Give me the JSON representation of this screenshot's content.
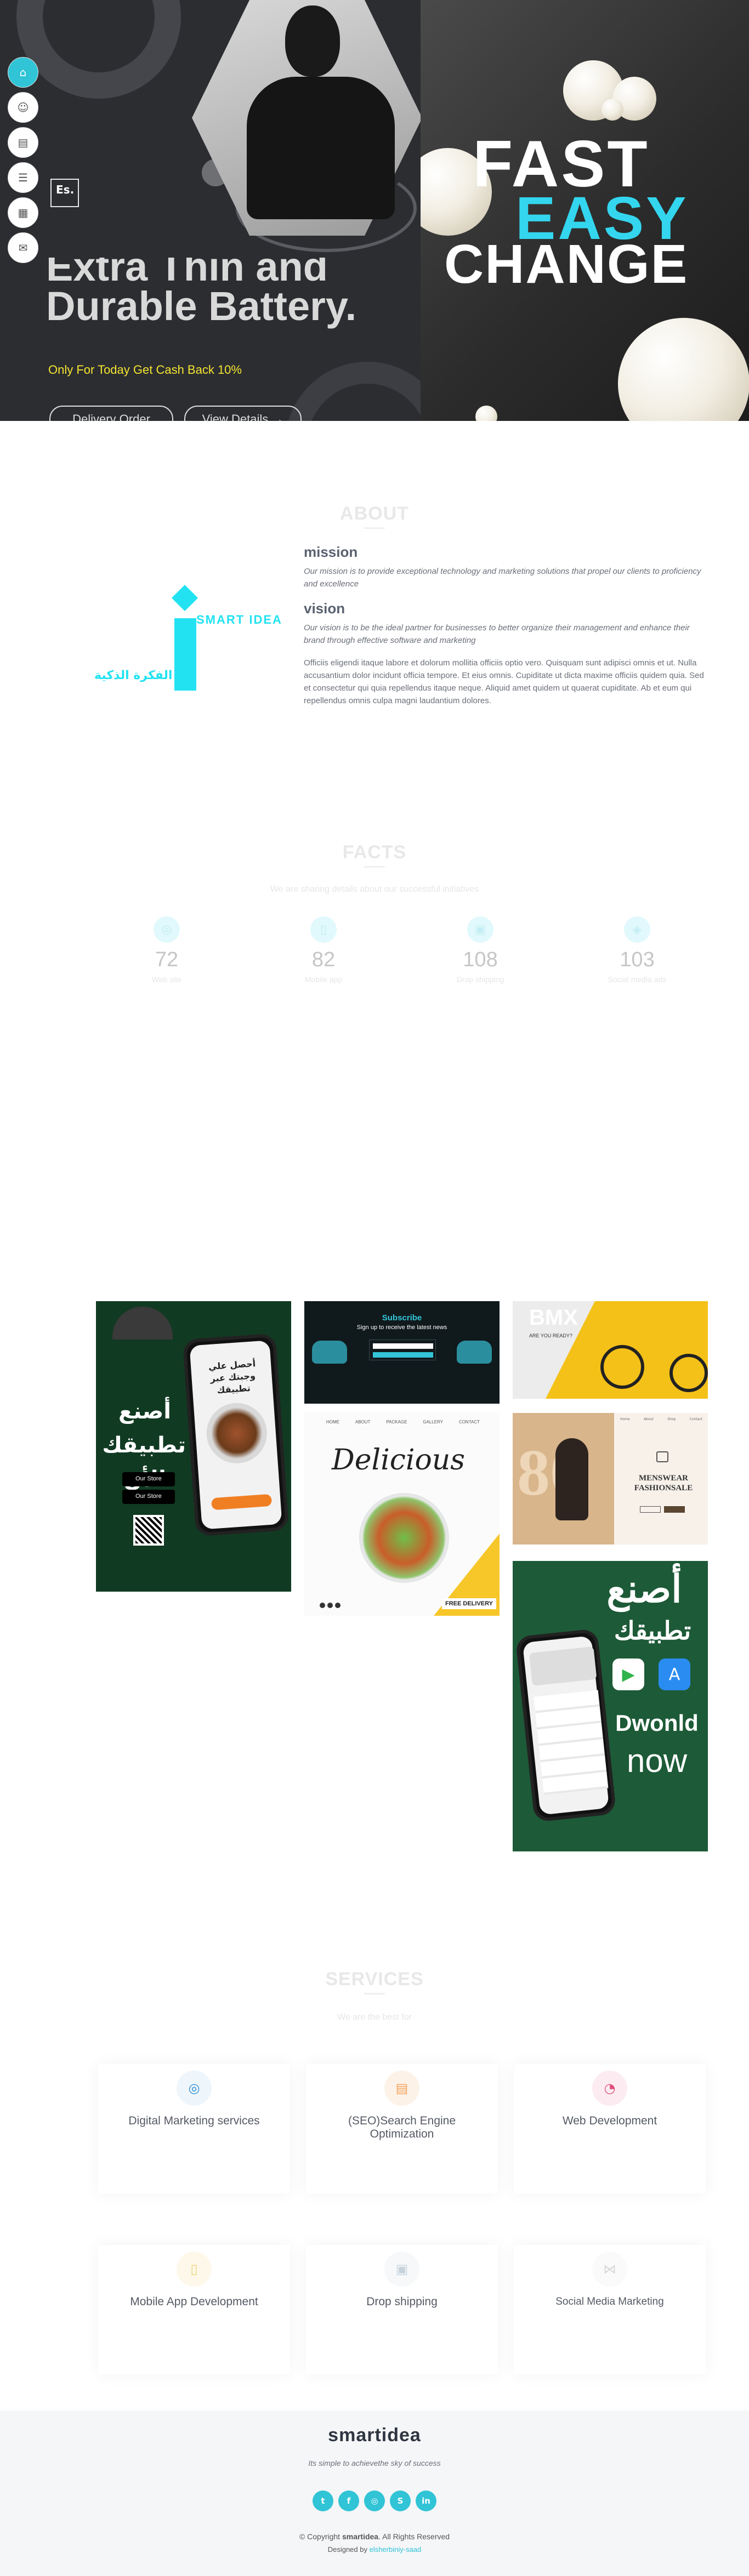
{
  "hero": {
    "title_line1": "Extra Thin and",
    "title_line2": "Durable Battery.",
    "promo": "Only For Today Get Cash Back 10%",
    "btn_delivery": "Delivery Order",
    "btn_view": "View Details",
    "view_arrow": "→",
    "badge": "Es.",
    "fast": "FAST",
    "easy": "EASY",
    "change": "CHANGE",
    "accent": "#33d6ee",
    "promo_color": "#f5e431",
    "side_nav": [
      "home-icon",
      "user-icon",
      "file-icon",
      "list-icon",
      "grid-icon",
      "chat-icon"
    ]
  },
  "about": {
    "title": "ABOUT",
    "mission_title": "mission",
    "mission_text": "Our mission is to provide exceptional technology and marketing solutions that propel our clients to proficiency and excellence",
    "vision_title": "vision",
    "vision_text": "Our vision is to be the ideal partner for businesses to better organize their management and enhance their brand through effective software and marketing",
    "body_text": "Officiis eligendi itaque labore et dolorum mollitia officiis optio vero. Quisquam sunt adipisci omnis et ut. Nulla accusantium dolor incidunt officia tempore. Et eius omnis. Cupiditate ut dicta maxime officiis quidem quia. Sed et consectetur qui quia repellendus itaque neque. Aliquid amet quidem ut quaerat cupiditate. Ab et eum qui repellendus omnis culpa magni laudantium dolores.",
    "logo_text": "SMART IDEA",
    "logo_arabic": "الفكرة الذكية",
    "logo_color": "#22e2f2"
  },
  "facts": {
    "title": "FACTS",
    "subtitle": "We are sharing details about our successful initiatives",
    "items": [
      {
        "num": "72",
        "label": "Web site",
        "icon": "globe-icon"
      },
      {
        "num": "82",
        "label": "Mobile app",
        "icon": "mobile-icon"
      },
      {
        "num": "108",
        "label": "Drop shipping",
        "icon": "box-icon"
      },
      {
        "num": "103",
        "label": "Social media ads",
        "icon": "megaphone-icon"
      }
    ]
  },
  "portfolio": {
    "app_card": {
      "arabic_big": "أصنع تطبيقك الأن",
      "arabic_small": "أحصل علي وجبتك عبر تطبيقك",
      "store1": "Our Store",
      "store2": "Our Store"
    },
    "subscribe_card": {
      "title": "Subscribe",
      "desc": "Sign up to receive the latest news"
    },
    "bmx_card": {
      "word": "BMX",
      "tagline": "ARE YOU READY?"
    },
    "delicious_card": {
      "nav": [
        "HOME",
        "ABOUT",
        "PACKAGE",
        "GALLERY",
        "CONTACT"
      ],
      "script": "Delicious",
      "free": "FREE DELIVERY"
    },
    "fashion_card": {
      "big_num": "80",
      "title": "MENSWEAR FASHIONSALE",
      "nav": [
        "Home",
        "About",
        "Shop",
        "Contact"
      ]
    },
    "download_card": {
      "arabic_1": "أصنع",
      "arabic_2": "تطبيقك",
      "word1": "Dwonld",
      "word2": "now"
    }
  },
  "services": {
    "title": "SERVICES",
    "subtitle": "We are the best for",
    "items": [
      {
        "label": "Digital Marketing services",
        "icon": "globe-icon",
        "icon_color": "#2f90d6",
        "icon_bg": "#eef6fc"
      },
      {
        "label": "(SEO)Search Engine Optimization",
        "icon": "file-icon",
        "icon_color": "#f2a35a",
        "icon_bg": "#fdf2e8"
      },
      {
        "label": "Web Development",
        "icon": "gauge-icon",
        "icon_color": "#e0507d",
        "icon_bg": "#fcecf1"
      },
      {
        "label": "Mobile App Development",
        "icon": "mobile-icon",
        "icon_color": "#f2d57a",
        "icon_bg": "#fdf8ea"
      },
      {
        "label": "Drop shipping",
        "icon": "box-icon",
        "icon_color": "#c6d3dd",
        "icon_bg": "#f6f8fa"
      },
      {
        "label": "Social Media Marketing",
        "icon": "share-icon",
        "icon_color": "#d8d8d8",
        "icon_bg": "#fafafa"
      }
    ]
  },
  "footer": {
    "brand": "smartidea",
    "tagline": "Its simple to achievethe sky of success",
    "social": [
      "twitter-icon",
      "facebook-icon",
      "instagram-icon",
      "skype-icon",
      "linkedin-icon"
    ],
    "copyright_prefix": "© Copyright ",
    "copyright_brand": "smartidea",
    "copyright_suffix": ". All Rights Reserved",
    "designed_prefix": "Designed by ",
    "designer": "elsherbiniy-saad",
    "accent": "#30c4d6"
  }
}
